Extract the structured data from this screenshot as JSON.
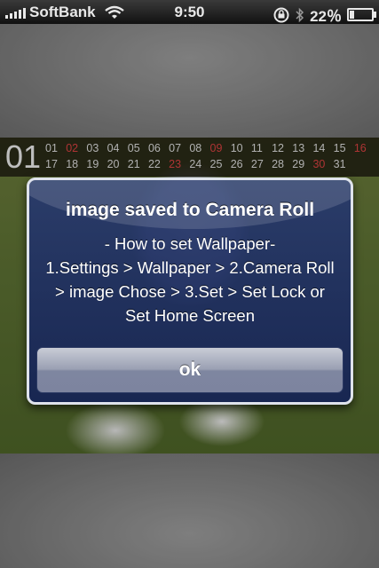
{
  "status_bar": {
    "carrier": "SoftBank",
    "time": "9:50",
    "battery": "22％",
    "battery_level": 0.22,
    "icons": [
      "signal-bars-icon",
      "wifi-icon",
      "orientation-lock-icon",
      "bluetooth-icon",
      "battery-icon"
    ]
  },
  "calendar": {
    "month": "01",
    "days": [
      "01",
      "02",
      "03",
      "04",
      "05",
      "06",
      "07",
      "08",
      "09",
      "10",
      "11",
      "12",
      "13",
      "14",
      "15",
      "16",
      "17",
      "18",
      "19",
      "20",
      "21",
      "22",
      "23",
      "24",
      "25",
      "26",
      "27",
      "28",
      "29",
      "30",
      "31"
    ],
    "red_days": [
      "02",
      "09",
      "16",
      "23",
      "30"
    ],
    "colors": {
      "text": "#d8d8d8",
      "highlight": "#d64040"
    }
  },
  "alert": {
    "title": "image saved to Camera Roll",
    "message": "- How to set Wallpaper-\n1.Settings > Wallpaper > 2.Camera Roll > image Chose > 3.Set > Set Lock or Set Home Screen",
    "ok_label": "ok",
    "colors": {
      "background": "#22356e",
      "border": "#dfe3ec"
    }
  }
}
